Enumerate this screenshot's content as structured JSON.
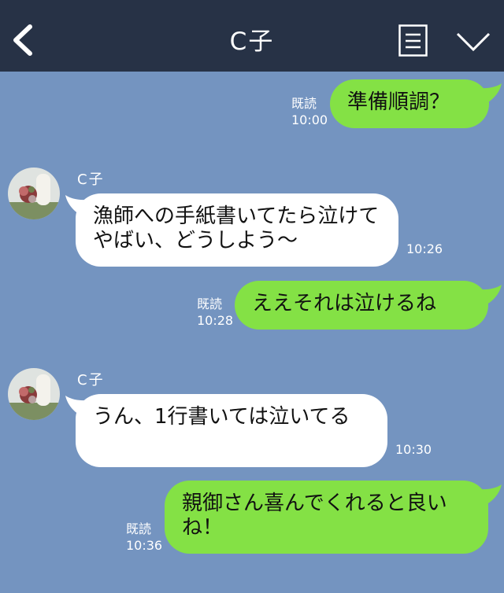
{
  "header": {
    "title": "C子"
  },
  "messages": [
    {
      "type": "sent",
      "text": "準備順調？",
      "read_label": "既読",
      "time": "10:00"
    },
    {
      "type": "received",
      "sender": "C子",
      "text": "漁師への手紙書いてたら泣けてやばい、どうしよう〜",
      "time": "10:26"
    },
    {
      "type": "sent",
      "text": "ええそれは泣けるね",
      "read_label": "既読",
      "time": "10:28"
    },
    {
      "type": "received",
      "sender": "C子",
      "text": "うん、1行書いては泣いてる",
      "time": "10:30"
    },
    {
      "type": "sent",
      "text": "親御さん喜んでくれると良いね！",
      "read_label": "既読",
      "time": "10:36"
    }
  ],
  "colors": {
    "background": "#7494c0",
    "header": "#273246",
    "sent_bubble": "#84e145",
    "received_bubble": "#ffffff"
  },
  "icons": [
    "back-icon",
    "menu-icon",
    "chevron-down-icon",
    "avatar"
  ]
}
